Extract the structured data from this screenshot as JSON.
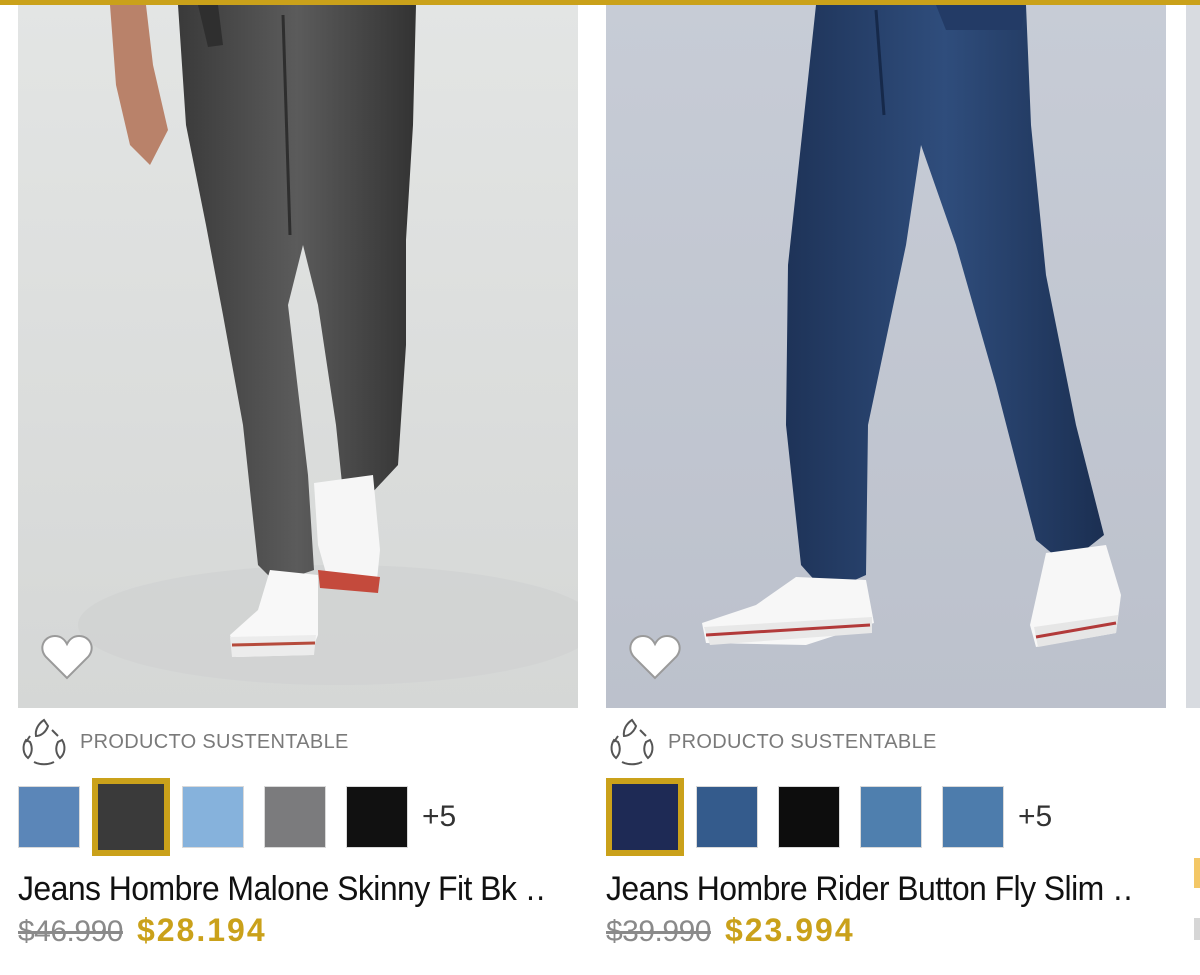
{
  "theme": {
    "accent": "#caa11a",
    "eco_gray": "#7a7a7a",
    "old_price": "#8a8a8a"
  },
  "products": [
    {
      "title": "Jeans Hombre Malone Skinny Fit Bk …",
      "old_price": "$46.990",
      "new_price": "$28.194",
      "eco_label": "PRODUCTO SUSTENTABLE",
      "more_colors": "+5",
      "swatch_colors": [
        "#5b86b8",
        "#3a3a3a",
        "#86b2dc",
        "#7b7b7d",
        "#111111"
      ],
      "selected_swatch": 1,
      "image_alt": "Model wearing dark gray skinny jeans with white sneakers"
    },
    {
      "title": "Jeans Hombre Rider Button Fly Slim …",
      "old_price": "$39.990",
      "new_price": "$23.994",
      "eco_label": "PRODUCTO SUSTENTABLE",
      "more_colors": "+5",
      "swatch_colors": [
        "#1e2a55",
        "#345b8c",
        "#0d0d0d",
        "#4f7fae",
        "#4d7cac"
      ],
      "selected_swatch": 0,
      "image_alt": "Model wearing dark blue slim jeans with white sneakers"
    }
  ]
}
